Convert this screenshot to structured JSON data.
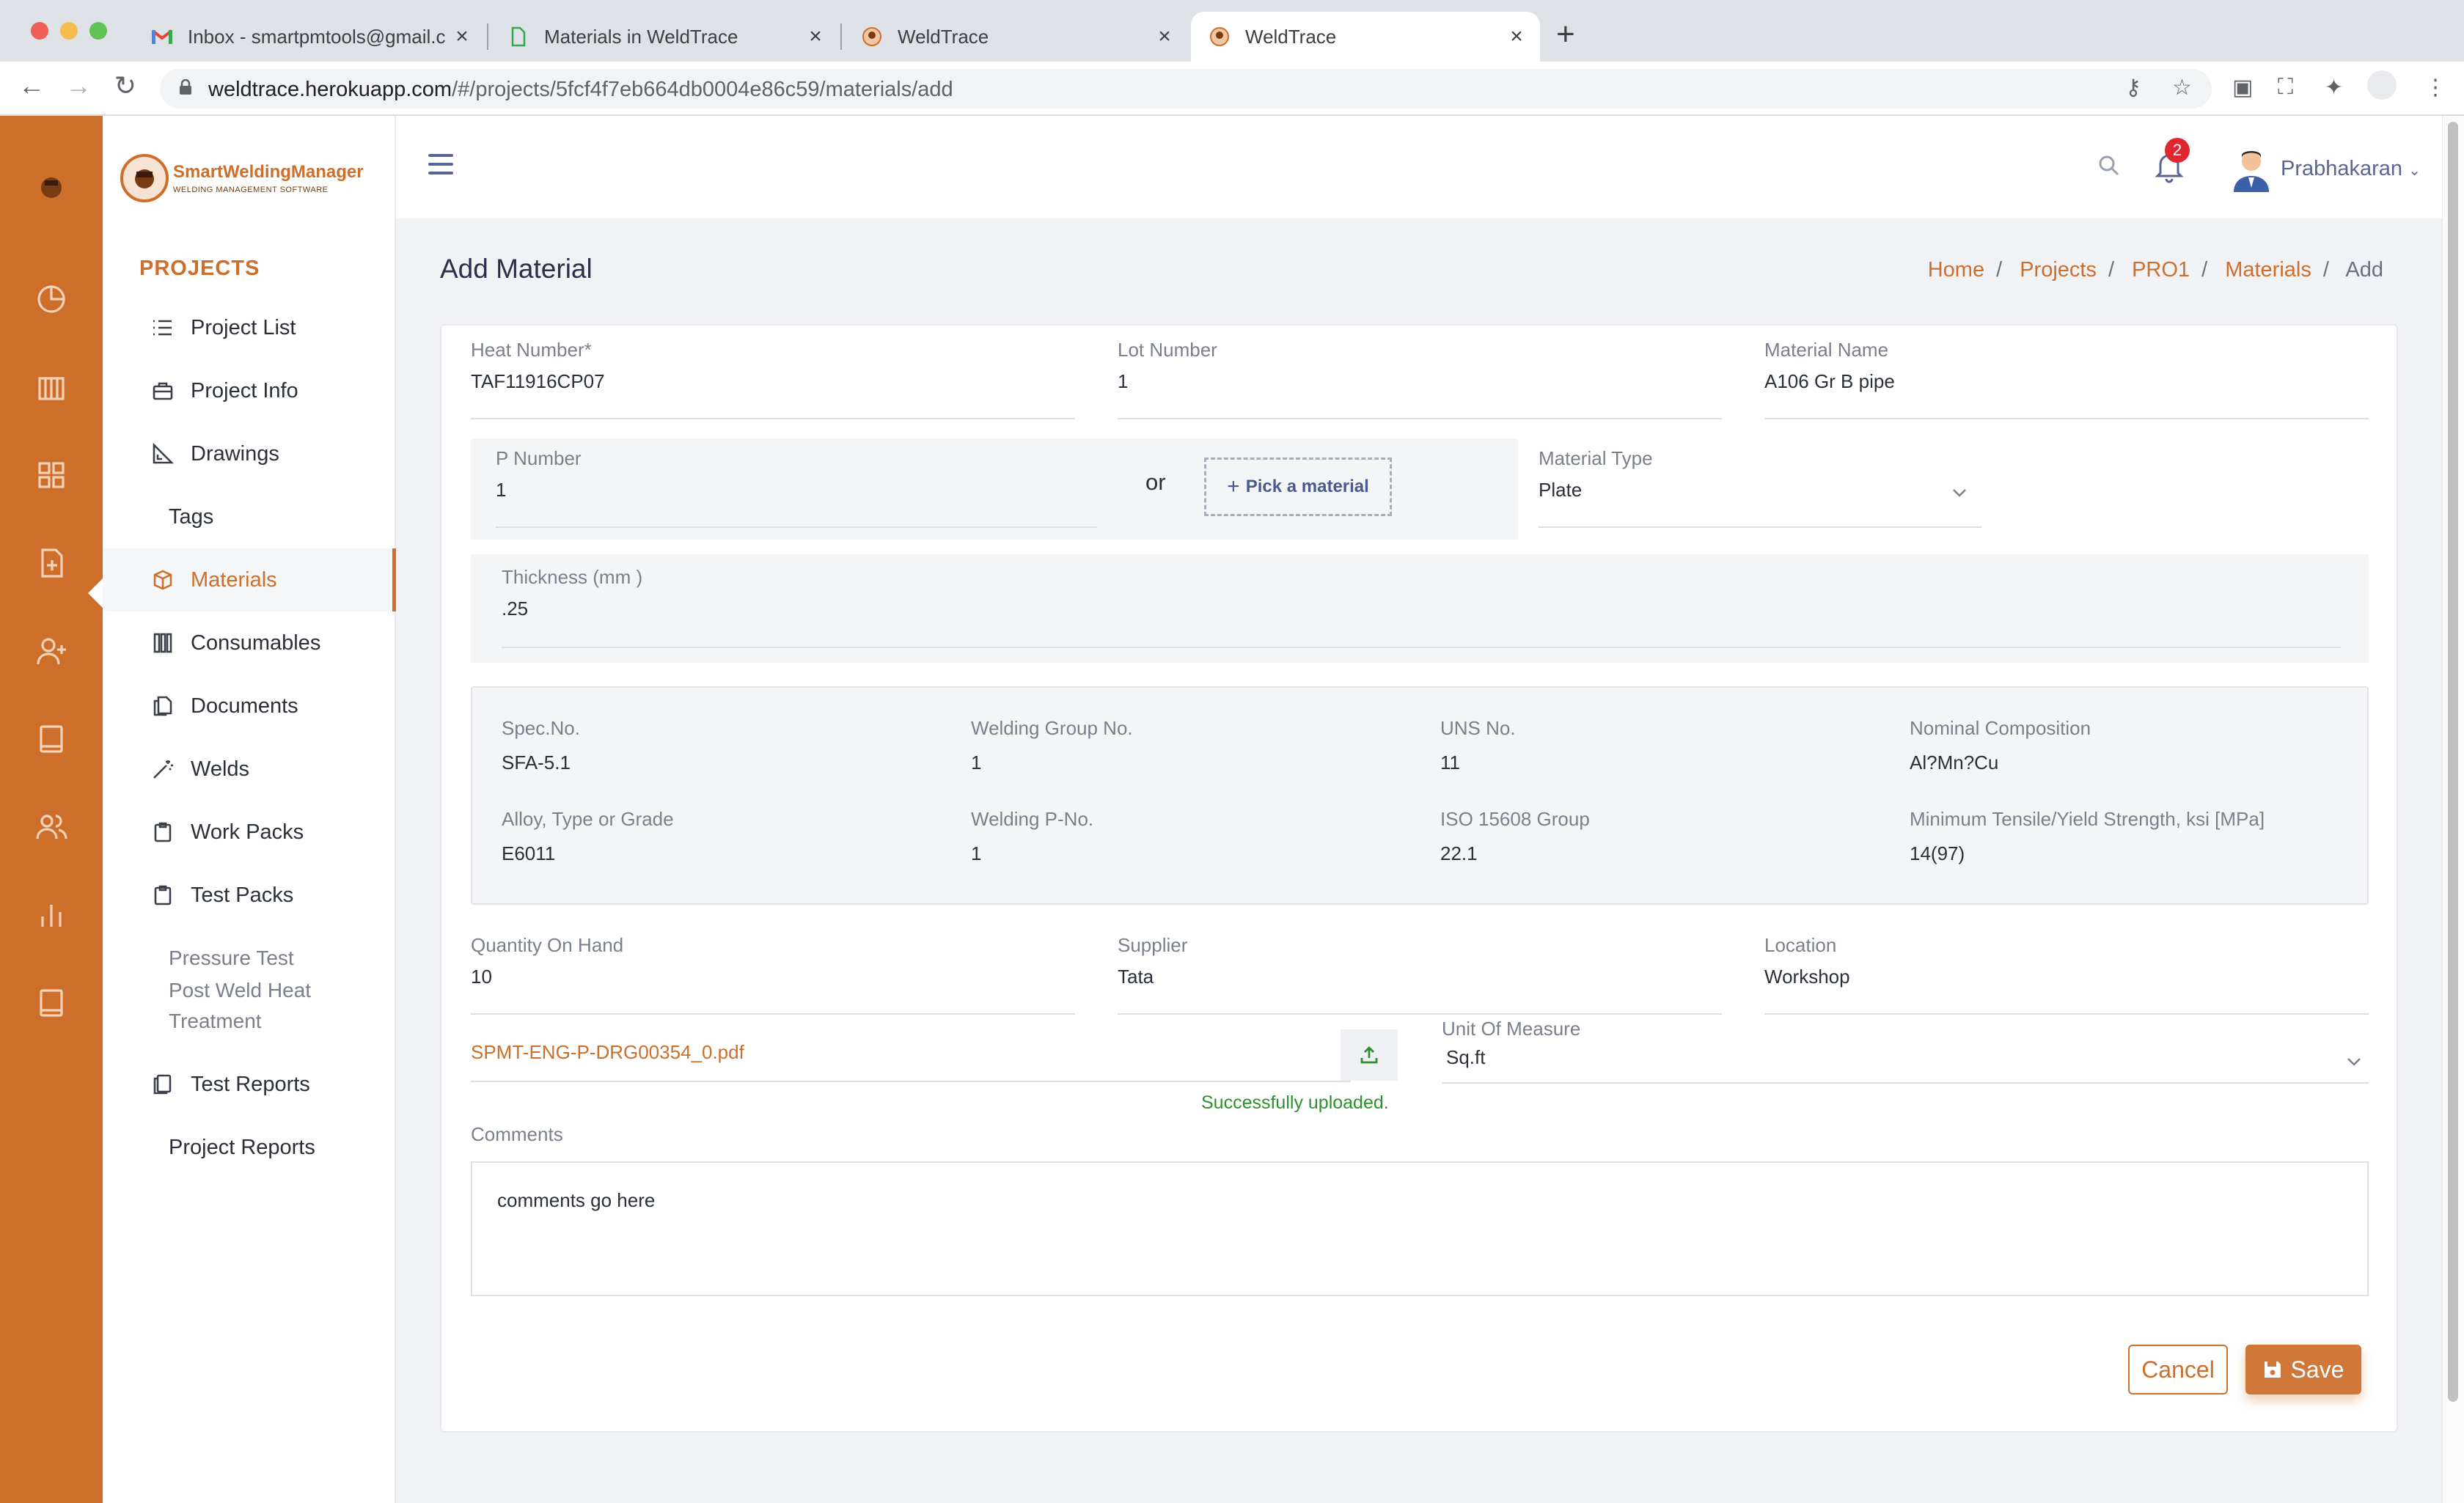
{
  "browser": {
    "tabs": [
      {
        "title": "Inbox - smartpmtools@gmail.c",
        "icon": "gmail-icon"
      },
      {
        "title": "Materials in WeldTrace",
        "icon": "weldtrace-doc-icon"
      },
      {
        "title": "WeldTrace",
        "icon": "weldtrace-logo-icon"
      },
      {
        "title": "WeldTrace",
        "icon": "weldtrace-logo-icon",
        "active": true
      }
    ],
    "url_host": "weldtrace.herokuapp.com",
    "url_path": "/#/projects/5fcf4f7eb664db0004e86c59/materials/add"
  },
  "sidebar": {
    "logo_title": "SmartWeldingManager",
    "logo_subtitle": "WELDING MANAGEMENT SOFTWARE",
    "section_title": "PROJECTS",
    "items": [
      {
        "label": "Project List",
        "icon": "list-icon"
      },
      {
        "label": "Project Info",
        "icon": "briefcase-icon"
      },
      {
        "label": "Drawings",
        "icon": "ruler-icon"
      },
      {
        "label": "Tags"
      },
      {
        "label": "Materials",
        "icon": "box-icon",
        "active": true
      },
      {
        "label": "Consumables",
        "icon": "rods-icon"
      },
      {
        "label": "Documents",
        "icon": "documents-icon"
      },
      {
        "label": "Welds",
        "icon": "wand-icon"
      },
      {
        "label": "Work Packs",
        "icon": "clipboard-icon"
      },
      {
        "label": "Test Packs",
        "icon": "clipboard-icon"
      },
      {
        "label": "Pressure Test"
      },
      {
        "label": "Post Weld Heat"
      },
      {
        "label": "Treatment"
      },
      {
        "label": "Test Reports",
        "icon": "reports-icon"
      },
      {
        "label": "Project Reports"
      }
    ]
  },
  "header": {
    "notification_count": "2",
    "user_name": "Prabhakaran"
  },
  "page": {
    "title": "Add Material",
    "breadcrumb": [
      "Home",
      "Projects",
      "PRO1",
      "Materials",
      "Add"
    ]
  },
  "form": {
    "heat_number": {
      "label": "Heat Number*",
      "value": "TAF11916CP07"
    },
    "lot_number": {
      "label": "Lot Number",
      "value": "1"
    },
    "material_name": {
      "label": "Material Name",
      "value": "A106 Gr B pipe"
    },
    "p_number": {
      "label": "P Number",
      "value": "1"
    },
    "or_text": "or",
    "pick_material": "Pick a material",
    "material_type": {
      "label": "Material Type",
      "value": "Plate"
    },
    "thickness": {
      "label": "Thickness (mm )",
      "value": ".25"
    },
    "spec": {
      "spec_no": {
        "label": "Spec.No.",
        "value": "SFA-5.1"
      },
      "welding_group_no": {
        "label": "Welding Group No.",
        "value": "1"
      },
      "uns_no": {
        "label": "UNS No.",
        "value": "11"
      },
      "nominal_composition": {
        "label": "Nominal Composition",
        "value": "Al?Mn?Cu"
      },
      "alloy": {
        "label": "Alloy, Type or Grade",
        "value": "E6011"
      },
      "welding_p_no": {
        "label": "Welding P-No.",
        "value": "1"
      },
      "iso_group": {
        "label": "ISO 15608 Group",
        "value": "22.1"
      },
      "min_tensile": {
        "label": "Minimum Tensile/Yield Strength, ksi [MPa]",
        "value": "14(97)"
      }
    },
    "quantity": {
      "label": "Quantity On Hand",
      "value": "10"
    },
    "supplier": {
      "label": "Supplier",
      "value": "Tata"
    },
    "location": {
      "label": "Location",
      "value": "Workshop"
    },
    "file_name": "SPMT-ENG-P-DRG00354_0.pdf",
    "upload_status": "Successfully uploaded.",
    "unit_of_measure": {
      "label": "Unit Of Measure",
      "value": "Sq.ft"
    },
    "comments": {
      "label": "Comments",
      "value": "comments go here"
    },
    "cancel_label": "Cancel",
    "save_label": "Save"
  },
  "colors": {
    "accent": "#cd6f2b",
    "rail": "#cd6f2b",
    "success": "#2e8f2e",
    "badge": "#e0262f"
  }
}
